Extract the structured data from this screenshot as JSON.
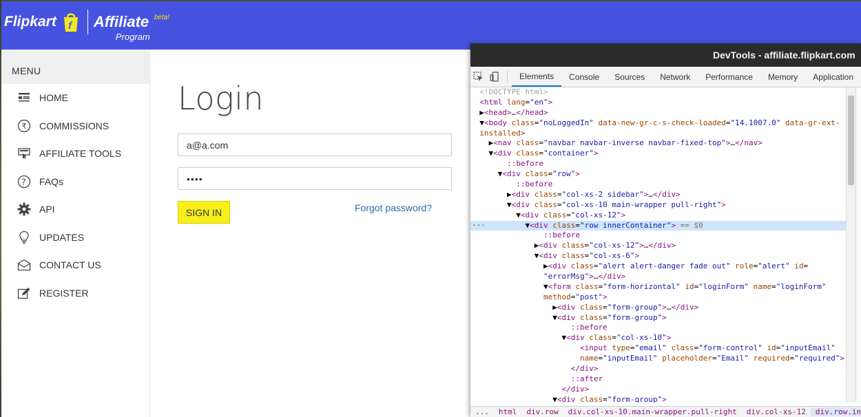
{
  "header": {
    "brand": "Flipkart",
    "affiliate": "Affiliate",
    "program": "Program",
    "beta": "beta!"
  },
  "sidebar": {
    "title": "MENU",
    "items": [
      {
        "label": "HOME",
        "icon": "home-list-icon"
      },
      {
        "label": "COMMISSIONS",
        "icon": "rupee-icon"
      },
      {
        "label": "AFFILIATE TOOLS",
        "icon": "tools-icon"
      },
      {
        "label": "FAQs",
        "icon": "question-icon"
      },
      {
        "label": "API",
        "icon": "gear-icon"
      },
      {
        "label": "UPDATES",
        "icon": "bulb-icon"
      },
      {
        "label": "CONTACT US",
        "icon": "envelope-icon"
      },
      {
        "label": "REGISTER",
        "icon": "edit-icon"
      }
    ]
  },
  "login": {
    "title": "Login",
    "email_value": "a@a.com",
    "password_value": "••••",
    "signin_label": "SIGN IN",
    "forgot_label": "Forgot password?"
  },
  "devtools": {
    "title": "DevTools - affiliate.flipkart.com",
    "tabs": [
      "Elements",
      "Console",
      "Sources",
      "Network",
      "Performance",
      "Memory",
      "Application"
    ],
    "active_tab": "Elements",
    "breadcrumb": [
      "html",
      "div.row",
      "div.col-xs-10.main-wrapper.pull-right",
      "div.col-xs-12",
      "div.row.innerContainer"
    ],
    "breadcrumb_more": "..."
  }
}
